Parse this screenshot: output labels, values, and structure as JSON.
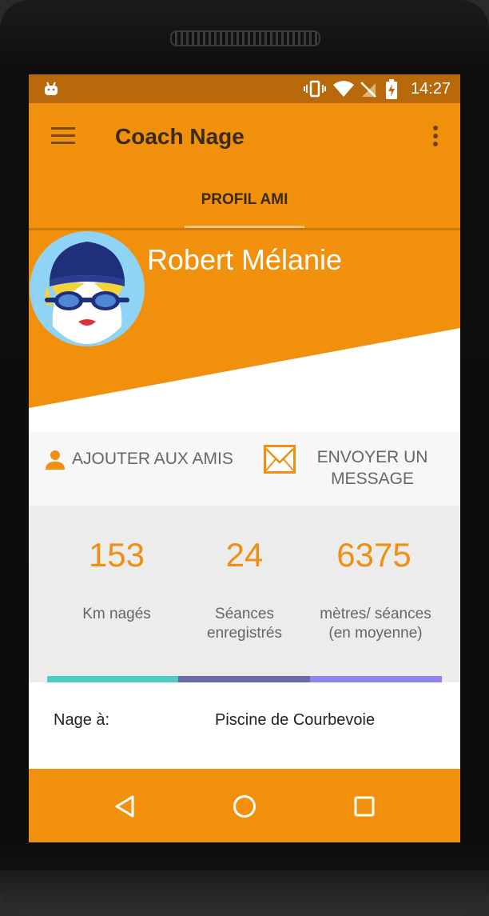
{
  "status_bar": {
    "time": "14:27"
  },
  "app_bar": {
    "title": "Coach Nage"
  },
  "tabs": [
    {
      "label": "PROFIL AMI"
    }
  ],
  "profile": {
    "name": "Robert  Mélanie"
  },
  "actions": {
    "add_friend": "AJOUTER AUX AMIS",
    "send_message": "ENVOYER UN MESSAGE"
  },
  "stats": [
    {
      "value": "153",
      "label": "Km nagés",
      "color": "#4ecdc4"
    },
    {
      "value": "24",
      "label": "Séances enregistrés",
      "color": "#6a6aa8"
    },
    {
      "value": "6375",
      "label": "mètres/ séances (en moyenne)",
      "color": "#8f85f0"
    }
  ],
  "info": {
    "label": "Nage à:",
    "value": "Piscine de Courbevoie"
  },
  "colors": {
    "primary": "#f0900c",
    "status_bar": "#b8690b",
    "accent_text": "#f08f12"
  }
}
